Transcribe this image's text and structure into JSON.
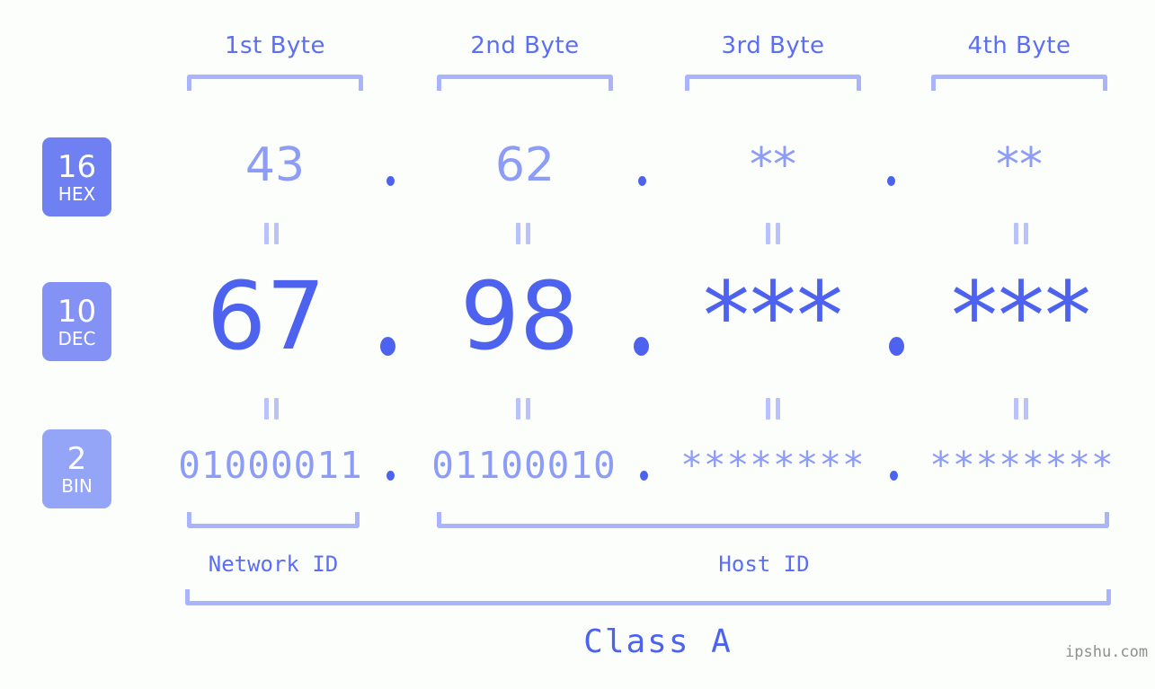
{
  "background_color": "#fcfefb",
  "accent_color": "#5b6ef5",
  "accent_light": "#8d9cf7",
  "bracket_color": "#aab4fb",
  "header": {
    "byte_labels": [
      {
        "label": "1st Byte"
      },
      {
        "label": "2nd Byte"
      },
      {
        "label": "3rd Byte"
      },
      {
        "label": "4th Byte"
      }
    ]
  },
  "rows": [
    {
      "base": "16",
      "abbr": "HEX",
      "badge_color": "#6f81f2",
      "values": [
        "43",
        "62",
        "**",
        "**"
      ],
      "separator": "."
    },
    {
      "base": "10",
      "abbr": "DEC",
      "badge_color": "#8592f5",
      "values": [
        "67",
        "98",
        "***",
        "***"
      ],
      "separator": "."
    },
    {
      "base": "2",
      "abbr": "BIN",
      "badge_color": "#94a4f7",
      "values": [
        "01000011",
        "01100010",
        "********",
        "********"
      ],
      "separator": "."
    }
  ],
  "equals_symbol": "=",
  "footer": {
    "network_id_label": "Network ID",
    "host_id_label": "Host ID",
    "class_label": "Class A",
    "watermark": "ipshu.com"
  }
}
